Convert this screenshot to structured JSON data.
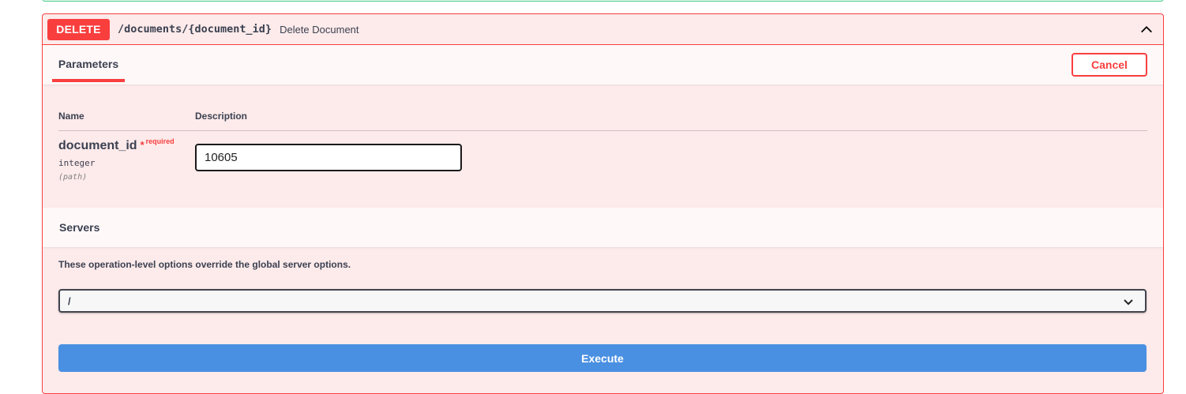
{
  "operation": {
    "method": "DELETE",
    "path": "/documents/{document_id}",
    "summary": "Delete Document"
  },
  "parameters": {
    "tab_label": "Parameters",
    "cancel_label": "Cancel",
    "col_name": "Name",
    "col_description": "Description",
    "items": [
      {
        "name": "document_id",
        "required_star": "*",
        "required_label": "required",
        "type": "integer",
        "in": "(path)",
        "value": "10605"
      }
    ]
  },
  "servers": {
    "title": "Servers",
    "note": "These operation-level options override the global server options.",
    "selected": "/"
  },
  "execute_label": "Execute",
  "colors": {
    "delete": "#f93e3e",
    "execute": "#4990e2",
    "background": "#fdeaea"
  },
  "icons": {
    "collapse": "chevron-up-icon",
    "select": "chevron-down-icon"
  }
}
